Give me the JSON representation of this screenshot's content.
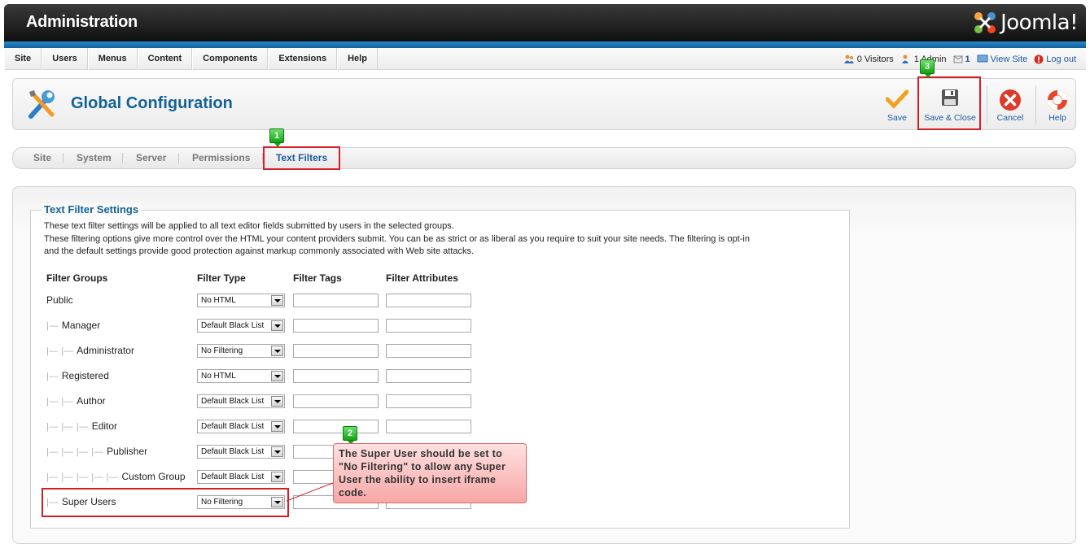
{
  "header": {
    "title": "Administration",
    "logo_text": "Joomla!"
  },
  "menu": {
    "items": [
      "Site",
      "Users",
      "Menus",
      "Content",
      "Components",
      "Extensions",
      "Help"
    ]
  },
  "status": {
    "visitors": "0 Visitors",
    "admins": "1 Admin",
    "messages": "1",
    "view_site": "View Site",
    "logout": "Log out"
  },
  "toolbar": {
    "page_title": "Global Configuration",
    "save": "Save",
    "save_close": "Save & Close",
    "cancel": "Cancel",
    "help": "Help"
  },
  "tabs": [
    {
      "label": "Site"
    },
    {
      "label": "System"
    },
    {
      "label": "Server"
    },
    {
      "label": "Permissions"
    },
    {
      "label": "Text Filters",
      "active": true
    }
  ],
  "filters": {
    "legend": "Text Filter Settings",
    "desc1": "These text filter settings will be applied to all text editor fields submitted by users in the selected groups.",
    "desc2": "These filtering options give more control over the HTML your content providers submit. You can be as strict or as liberal as you require to suit your site needs. The filtering is opt-in",
    "desc3": "and the default settings provide good protection against markup commonly associated with Web site attacks.",
    "headers": [
      "Filter Groups",
      "Filter Type",
      "Filter Tags",
      "Filter Attributes"
    ],
    "rows": [
      {
        "group": "Public",
        "depth": 0,
        "type": "No HTML",
        "tags": "",
        "attributes": ""
      },
      {
        "group": "Manager",
        "depth": 1,
        "type": "Default Black List",
        "tags": "",
        "attributes": ""
      },
      {
        "group": "Administrator",
        "depth": 2,
        "type": "No Filtering",
        "tags": "",
        "attributes": ""
      },
      {
        "group": "Registered",
        "depth": 1,
        "type": "No HTML",
        "tags": "",
        "attributes": ""
      },
      {
        "group": "Author",
        "depth": 2,
        "type": "Default Black List",
        "tags": "",
        "attributes": ""
      },
      {
        "group": "Editor",
        "depth": 3,
        "type": "Default Black List",
        "tags": "",
        "attributes": ""
      },
      {
        "group": "Publisher",
        "depth": 4,
        "type": "Default Black List",
        "tags": "",
        "attributes": ""
      },
      {
        "group": "Custom Group",
        "depth": 5,
        "type": "Default Black List",
        "tags": "",
        "attributes": ""
      },
      {
        "group": "Super Users",
        "depth": 1,
        "type": "No Filtering",
        "tags": "",
        "attributes": ""
      }
    ]
  },
  "annotations": {
    "badge1": "1",
    "badge2": "2",
    "badge3": "3",
    "callout": "The Super User should be set to \"No Filtering\" to allow any Super User the ability to insert iframe code.",
    "highlight_color": "#d41f27",
    "badge_color": "#15a415"
  }
}
